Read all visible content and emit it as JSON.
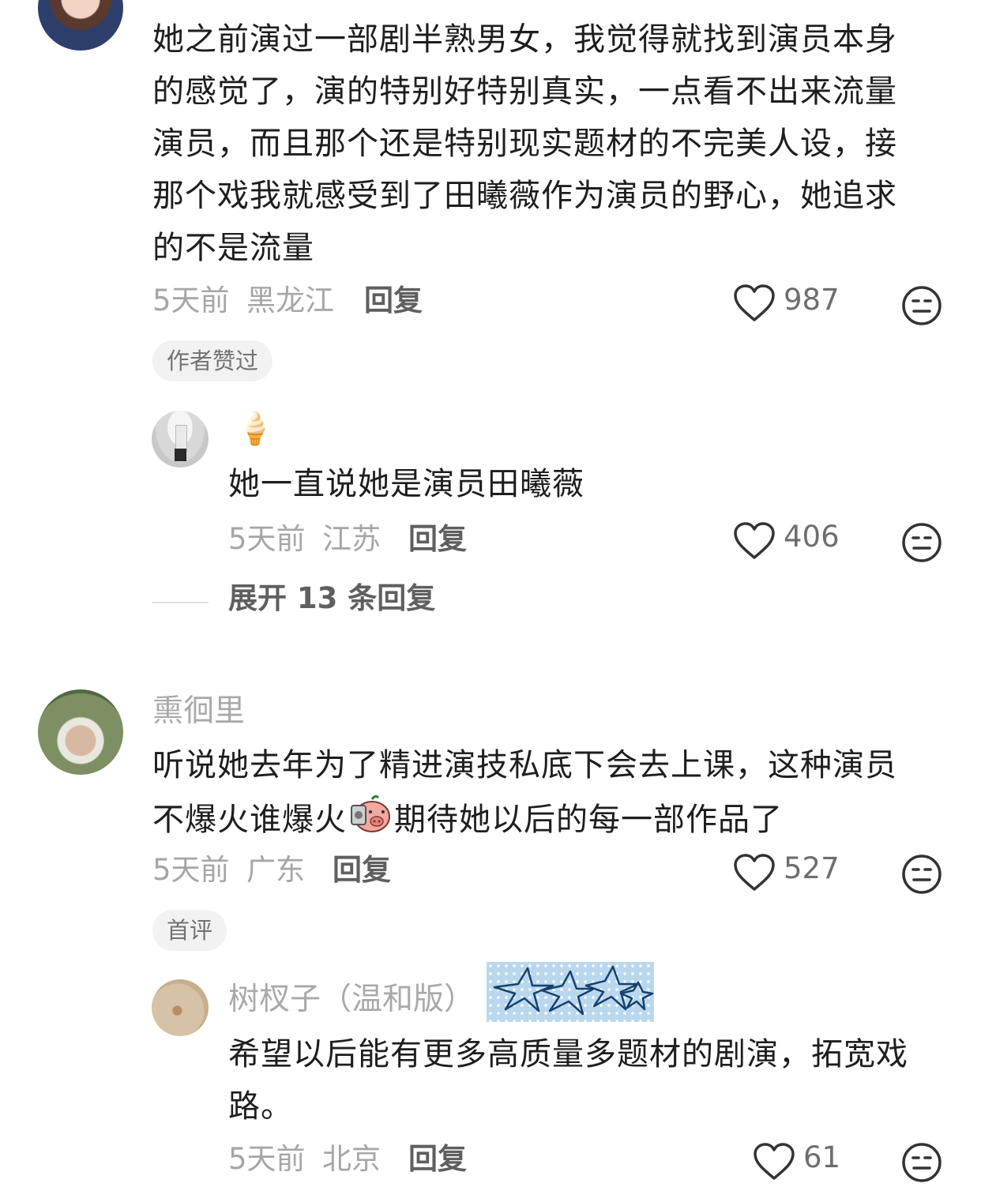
{
  "comments": [
    {
      "text_lines": [
        "她之前演过一部剧半熟男女，我觉得就找到演员本身",
        "的感觉了，演的特别好特别真实，一点看不出来流量",
        "演员，而且那个还是特别现实题材的不完美人设，接",
        "那个戏我就感受到了田曦薇作为演员的野心，她追求",
        "的不是流量"
      ],
      "time": "5天前",
      "location": "黑龙江",
      "reply_label": "回复",
      "likes": "987",
      "badge": "作者赞过",
      "reply": {
        "nickname_emoji": "🍦",
        "text": "她一直说她是演员田曦薇",
        "time": "5天前",
        "location": "江苏",
        "reply_label": "回复",
        "likes": "406"
      },
      "expand_label": "展开 13 条回复"
    },
    {
      "nickname": "熏徊里",
      "text_lines": [
        "听说她去年为了精进演技私底下会去上课，这种演员",
        "不爆火谁爆火",
        "期待她以后的每一部作品了"
      ],
      "time": "5天前",
      "location": "广东",
      "reply_label": "回复",
      "likes": "527",
      "badge": "首评",
      "reply": {
        "nickname": "树杈子（温和版）",
        "text_lines": [
          "希望以后能有更多高质量多题材的剧演，拓宽戏",
          "路。"
        ],
        "time": "5天前",
        "location": "北京",
        "reply_label": "回复",
        "likes": "61"
      }
    }
  ],
  "icons": {
    "like": "heart-outline-icon",
    "dislike": "neutral-face-icon",
    "sticker": "pig-sticker-icon",
    "badge_decor": "blue-stars-decoration"
  },
  "colors": {
    "text": "#1e1e1e",
    "meta": "#a6a6a6",
    "icon": "#333333",
    "badge_bg": "#f2f2f2",
    "stars_bg": "#b9d8ee"
  }
}
